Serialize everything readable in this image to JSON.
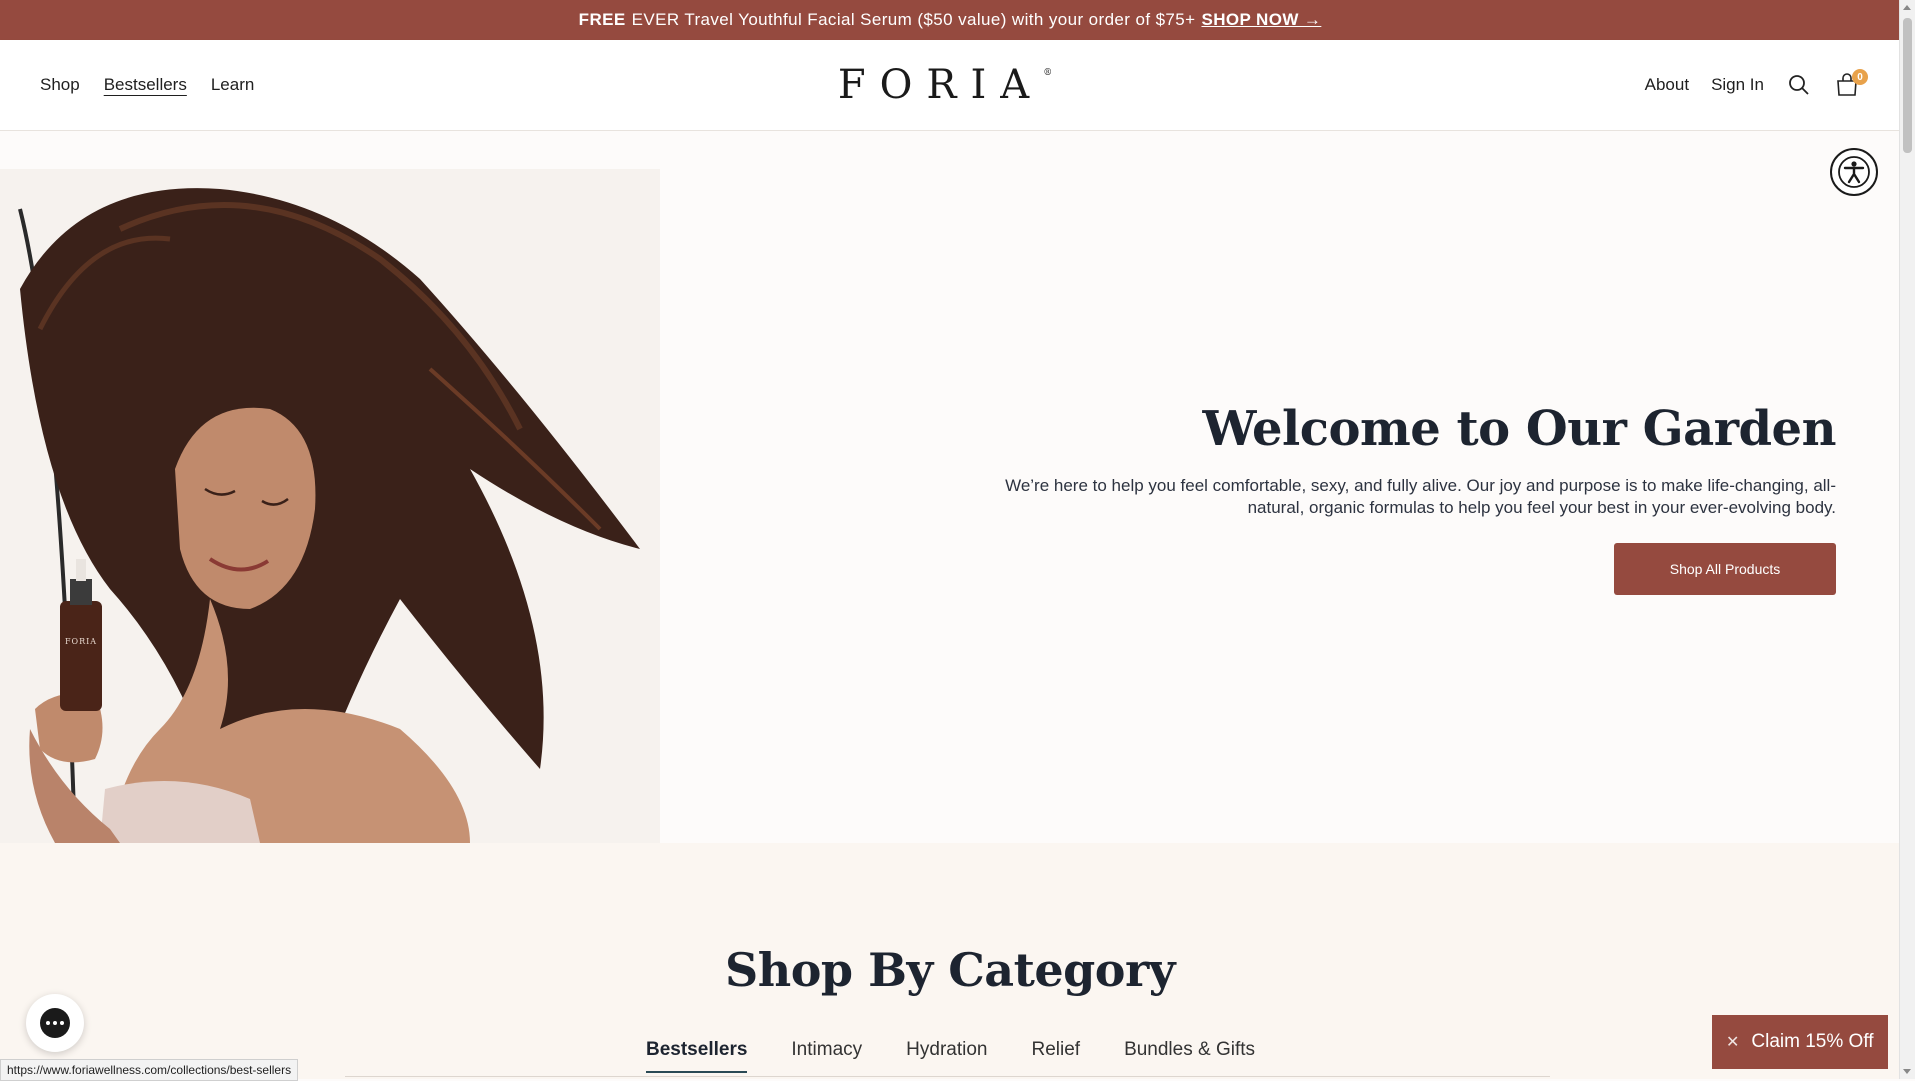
{
  "announcement": {
    "bold_prefix": "FREE",
    "text": "EVER Travel Youthful Facial Serum ($50 value) with your order of $75+",
    "link_label": "SHOP NOW →"
  },
  "header": {
    "nav_left": [
      "Shop",
      "Bestsellers",
      "Learn"
    ],
    "logo": "FORIA",
    "logo_mark": "®",
    "nav_right": {
      "about": "About",
      "sign_in": "Sign In"
    },
    "cart_count": "0"
  },
  "hero": {
    "title": "Welcome to Our Garden",
    "description_line1": "We’re here to help you feel comfortable, sexy, and fully alive. Our joy and purpose is to make life-changing, all-",
    "description_line2": "natural, organic formulas to help you feel your best in your ever-evolving body.",
    "cta": "Shop All Products",
    "bottle_label": "FORIA"
  },
  "category": {
    "title": "Shop By Category",
    "tabs": [
      "Bestsellers",
      "Intimacy",
      "Hydration",
      "Relief",
      "Bundles & Gifts"
    ],
    "active_tab": "Bestsellers"
  },
  "claim": {
    "label": "Claim 15% Off"
  },
  "status_url": "https://www.foriawellness.com/collections/best-sellers",
  "colors": {
    "brand": "#954a3f",
    "dark_text": "#1d2430",
    "badge": "#e8a24b"
  },
  "icons": [
    "search-icon",
    "cart-icon",
    "accessibility-icon",
    "chat-icon",
    "close-icon"
  ]
}
